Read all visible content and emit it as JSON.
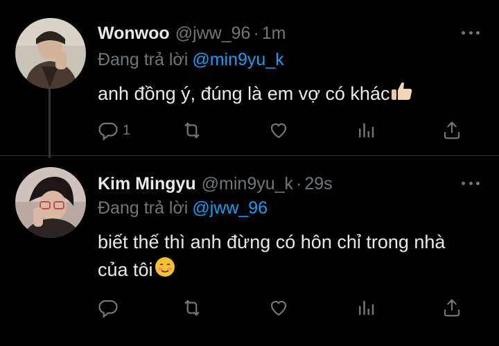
{
  "tweets": [
    {
      "author_name": "Wonwoo",
      "handle": "@jww_96",
      "separator": "·",
      "time": "1m",
      "replying_prefix": "Đang trả lời",
      "replying_to": "@min9yu_k",
      "text": "anh đồng ý, đúng là em vợ có khác",
      "emoji": "thumbs-up",
      "reply_count": "1"
    },
    {
      "author_name": "Kim Mingyu",
      "handle": "@min9yu_k",
      "separator": "·",
      "time": "29s",
      "replying_prefix": "Đang trả lời",
      "replying_to": "@jww_96",
      "text_line1": "biết thế thì anh đừng có hôn chỉ trong nhà",
      "text_line2": "của tôi",
      "emoji": "smiling-face",
      "reply_count": ""
    }
  ],
  "colors": {
    "background": "#000000",
    "text": "#e7e9ea",
    "muted": "#71767b",
    "link": "#1d9bf0"
  }
}
